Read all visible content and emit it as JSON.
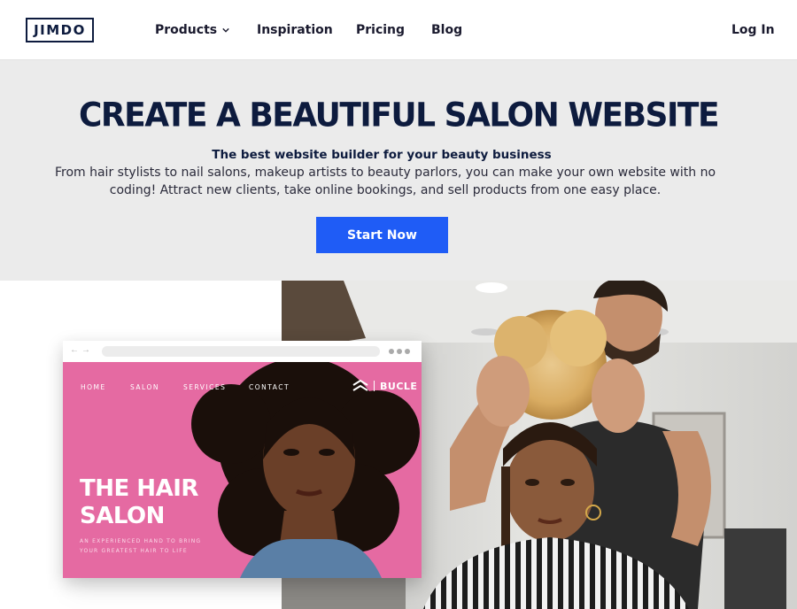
{
  "header": {
    "logo": "JIMDO",
    "nav": {
      "products": "Products",
      "inspiration": "Inspiration",
      "pricing": "Pricing",
      "blog": "Blog"
    },
    "login": "Log In"
  },
  "hero": {
    "title": "CREATE A BEAUTIFUL SALON WEBSITE",
    "subtitle": "The best website builder for your beauty business",
    "description": "From hair stylists to nail salons, makeup artists to beauty parlors, you can make your own website with no coding! Attract new clients, take online bookings, and sell products from one easy place.",
    "cta": "Start Now"
  },
  "mockup": {
    "nav": [
      "HOME",
      "SALON",
      "SERVICES",
      "CONTACT"
    ],
    "brand": "BUCLE",
    "headline_line1": "THE HAIR",
    "headline_line2": "SALON",
    "tagline_line1": "AN EXPERIENCED HAND TO BRING",
    "tagline_line2": "YOUR GREATEST HAIR TO LIFE"
  },
  "colors": {
    "navy": "#0d1b3e",
    "cta_blue": "#1f5cf6",
    "hero_bg": "#ebebeb",
    "mock_pink": "#e56aa2"
  },
  "icons": {
    "products_dropdown": "chevron-down-icon",
    "brand_logo": "bucle-chevrons-icon",
    "browser_back_forward": "arrow-icons",
    "browser_menu": "more-dots-icon"
  }
}
